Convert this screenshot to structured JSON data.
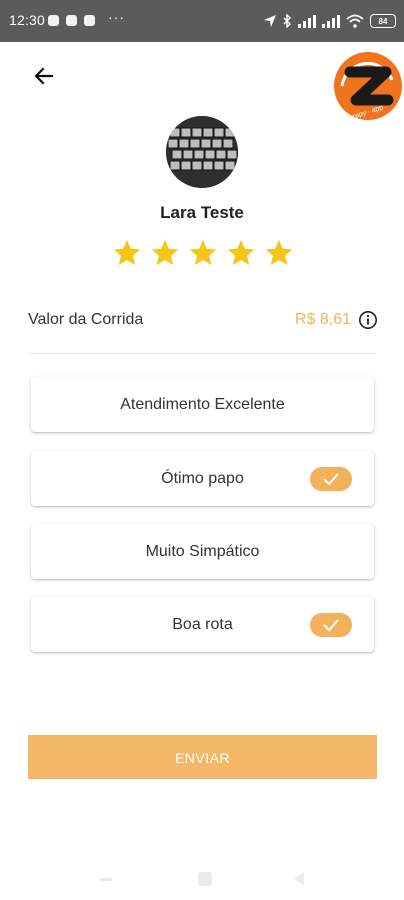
{
  "status_bar": {
    "time": "12:30",
    "dots": "···",
    "battery": "84"
  },
  "driver": {
    "name": "Lara Teste",
    "rating_stars": 5
  },
  "fare": {
    "label": "Valor da Corrida",
    "value": "R$ 8,61"
  },
  "options": [
    {
      "label": "Atendimento Excelente",
      "checked": false
    },
    {
      "label": "Ótimo papo",
      "checked": true
    },
    {
      "label": "Muito Simpático",
      "checked": false
    },
    {
      "label": "Boa rota",
      "checked": true
    }
  ],
  "submit_label": "ENVIAR",
  "logo_text": "zapy · app",
  "colors": {
    "accent": "#f3b15c",
    "star": "#f5c518",
    "status_bar": "#5b5b5b"
  }
}
